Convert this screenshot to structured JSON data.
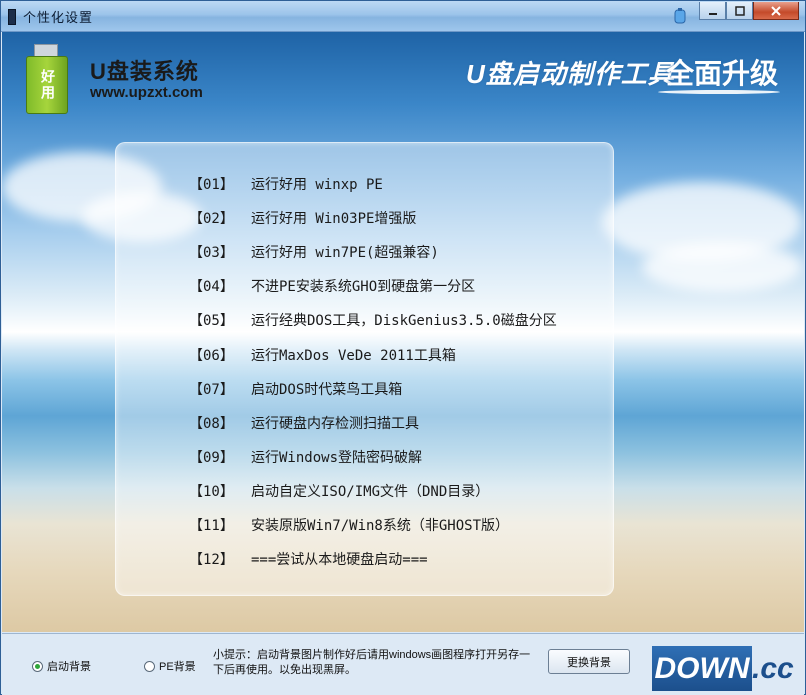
{
  "window": {
    "title": "个性化设置"
  },
  "banner": {
    "logo_badge": "好用",
    "brand_name": "U盘装系统",
    "brand_url": "www.upzxt.com",
    "slogan_left": "U盘启动制作工具",
    "slogan_right": "全面升级"
  },
  "menu": {
    "items": [
      {
        "num": "【01】",
        "label": "运行好用 winxp PE"
      },
      {
        "num": "【02】",
        "label": "运行好用 Win03PE增强版"
      },
      {
        "num": "【03】",
        "label": "运行好用 win7PE(超强兼容)"
      },
      {
        "num": "【04】",
        "label": "不进PE安装系统GHO到硬盘第一分区"
      },
      {
        "num": "【05】",
        "label": "运行经典DOS工具，DiskGenius3.5.0磁盘分区"
      },
      {
        "num": "【06】",
        "label": "运行MaxDos VeDe 2011工具箱"
      },
      {
        "num": "【07】",
        "label": "启动DOS时代菜鸟工具箱"
      },
      {
        "num": "【08】",
        "label": "运行硬盘内存检测扫描工具"
      },
      {
        "num": "【09】",
        "label": "运行Windows登陆密码破解"
      },
      {
        "num": "【10】",
        "label": "启动自定义ISO/IMG文件（DND目录）"
      },
      {
        "num": "【11】",
        "label": "安装原版Win7/Win8系统（非GHOST版）"
      },
      {
        "num": "【12】",
        "label": "===尝试从本地硬盘启动==="
      }
    ]
  },
  "bottom": {
    "radio_boot_bg": "启动背景",
    "radio_pe_bg": "PE背景",
    "tip": "小提示：启动背景图片制作好后请用windows画图程序打开另存一下后再使用。以免出现黑屏。",
    "change_bg_label": "更换背景",
    "watermark_down": "DOWN",
    "watermark_cc": ".cc"
  }
}
